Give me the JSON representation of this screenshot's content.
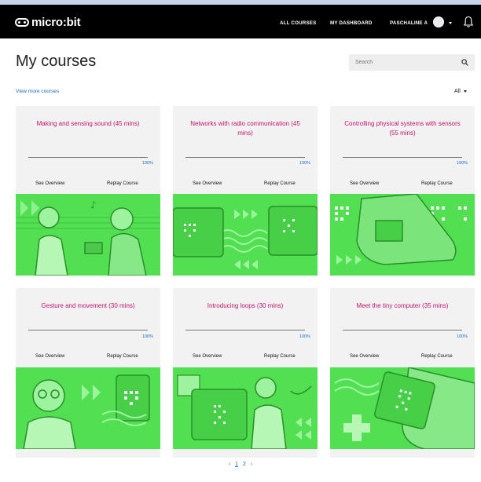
{
  "header": {
    "logo_text": "micro:bit",
    "nav": {
      "all_courses": "ALL COURSES",
      "dashboard": "MY DASHBOARD",
      "user": "PASCHALINE A"
    }
  },
  "page": {
    "title": "My courses",
    "search_placeholder": "Search",
    "view_more": "View more courses",
    "filter": "All"
  },
  "courses": [
    {
      "title": "Making and sensing sound (45 mins)",
      "progress": "100%",
      "overview": "See Overview",
      "replay": "Replay Course"
    },
    {
      "title": "Networks with radio communication (45 mins)",
      "progress": "100%",
      "overview": "See Overview",
      "replay": "Replay Course"
    },
    {
      "title": "Controlling physical systems with sensors (55 mins)",
      "progress": "100%",
      "overview": "See Overview",
      "replay": "Replay Course"
    },
    {
      "title": "Gesture and movement (30 mins)",
      "progress": "100%",
      "overview": "See Overview",
      "replay": "Replay Course"
    },
    {
      "title": "Introducing loops (30 mins)",
      "progress": "100%",
      "overview": "See Overview",
      "replay": "Replay Course"
    },
    {
      "title": "Meet the tiny computer (35 mins)",
      "progress": "100%",
      "overview": "See Overview",
      "replay": "Replay Course"
    }
  ],
  "pagination": {
    "prev": "‹",
    "page1": "1",
    "page2": "2",
    "next": "›"
  },
  "colors": {
    "nav_bg": "#000000",
    "accent_title": "#c2126d",
    "link": "#1b6ac9",
    "art_green": "#52e052"
  }
}
